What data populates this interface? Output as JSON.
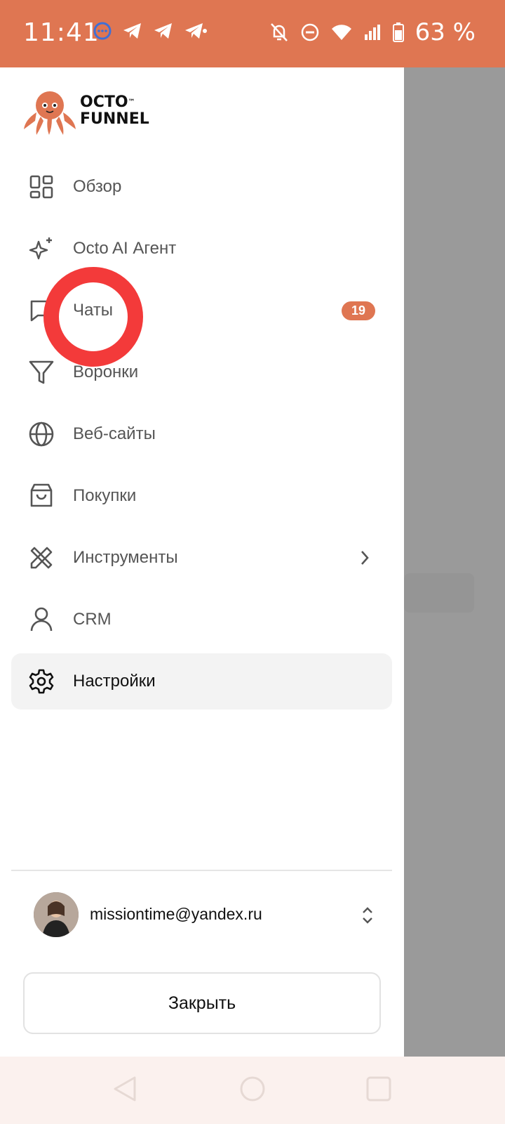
{
  "status_bar": {
    "time": "11:41",
    "battery": "63 %",
    "icons": [
      "chat-bubble-icon",
      "telegram-icon",
      "telegram-icon",
      "telegram-icon",
      "bell-off-icon",
      "do-not-disturb-icon",
      "wifi-icon",
      "signal-icon",
      "battery-icon"
    ]
  },
  "brand": {
    "logo_line1": "OCTO",
    "logo_line2": "FUNNEL",
    "tm": "™",
    "accent": "#df7652"
  },
  "menu": {
    "items": [
      {
        "label": "Обзор",
        "icon": "dashboard-icon"
      },
      {
        "label": "Octo AI Агент",
        "icon": "sparkles-icon"
      },
      {
        "label": "Чаты",
        "icon": "chat-icon",
        "badge": "19"
      },
      {
        "label": "Воронки",
        "icon": "funnel-icon"
      },
      {
        "label": "Веб-сайты",
        "icon": "globe-icon"
      },
      {
        "label": "Покупки",
        "icon": "shopping-bag-icon"
      },
      {
        "label": "Инструменты",
        "icon": "tools-icon"
      },
      {
        "label": "CRM",
        "icon": "user-icon"
      },
      {
        "label": "Настройки",
        "icon": "gear-icon",
        "active": true
      }
    ]
  },
  "account": {
    "email": "missiontime@yandex.ru"
  },
  "close_button": {
    "label": "Закрыть"
  },
  "nav": {
    "buttons": [
      "back-icon",
      "home-icon",
      "recents-icon"
    ]
  }
}
